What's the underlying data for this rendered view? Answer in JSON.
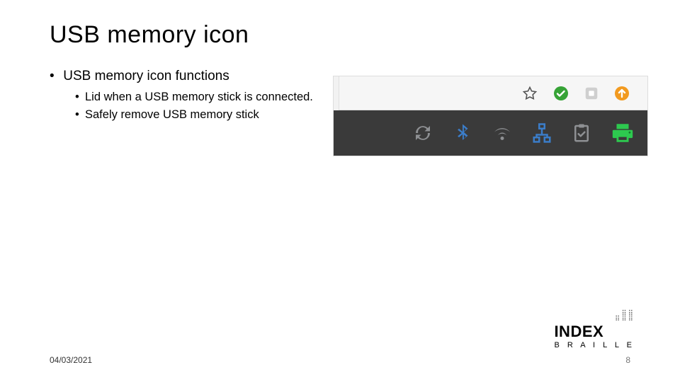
{
  "title": "USB memory icon",
  "bullets": {
    "lvl1_0": "USB memory icon functions",
    "lvl2_0": "Lid when a USB memory stick is connected.",
    "lvl2_1": "Safely remove USB memory stick"
  },
  "toolbar_icons": {
    "star": "star-outline",
    "check": "check-circle-green",
    "stop": "square-grey",
    "update": "arrow-up-orange"
  },
  "tray_icons": {
    "sync": "sync",
    "bluetooth": "bluetooth",
    "wifi": "wifi",
    "network": "network-wired",
    "clipboard": "clipboard-check",
    "printer": "printer-green"
  },
  "footer": {
    "date": "04/03/2021",
    "page": "8"
  },
  "logo": {
    "line1": "INDEX",
    "line2": "B R A I L L E"
  }
}
